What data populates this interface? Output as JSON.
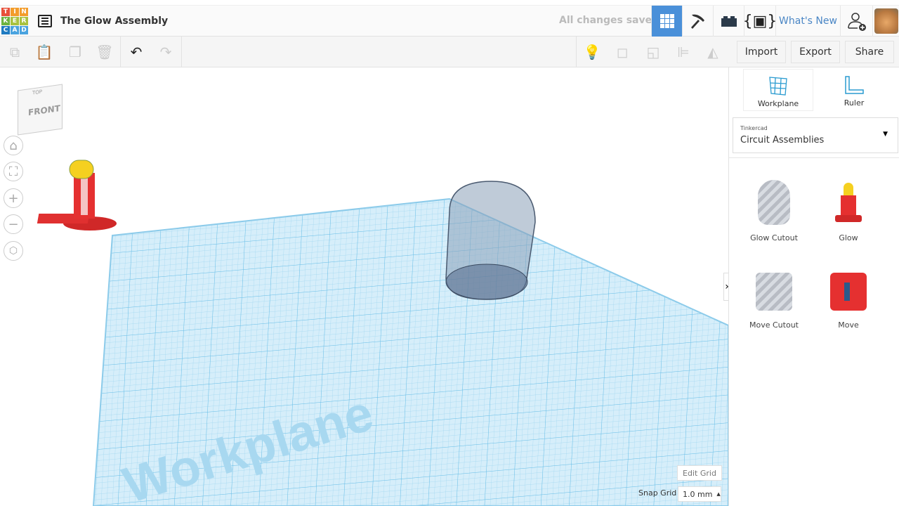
{
  "header": {
    "title": "The Glow Assembly",
    "status": "All changes saved",
    "whats_new": "What's New",
    "logo_letters": [
      "T",
      "I",
      "N",
      "K",
      "E",
      "R",
      "C",
      "A",
      "D"
    ]
  },
  "toolbar": {
    "import": "Import",
    "export": "Export",
    "share": "Share"
  },
  "viewcube": {
    "front": "FRONT",
    "top": "TOP"
  },
  "sidebar": {
    "workplane": "Workplane",
    "ruler": "Ruler",
    "library_caption": "Tinkercad",
    "library_value": "Circuit Assemblies",
    "parts": [
      {
        "label": "Glow Cutout"
      },
      {
        "label": "Glow"
      },
      {
        "label": "Move Cutout"
      },
      {
        "label": "Move"
      }
    ]
  },
  "viewport": {
    "workplane_label": "Workplane",
    "edit_grid": "Edit Grid",
    "snap_grid_label": "Snap Grid",
    "snap_grid_value": "1.0 mm"
  },
  "colors": {
    "accent": "#4a90d9",
    "grid": "#8fd0ef",
    "part_red": "#e53030",
    "part_yellow": "#f5d020"
  }
}
